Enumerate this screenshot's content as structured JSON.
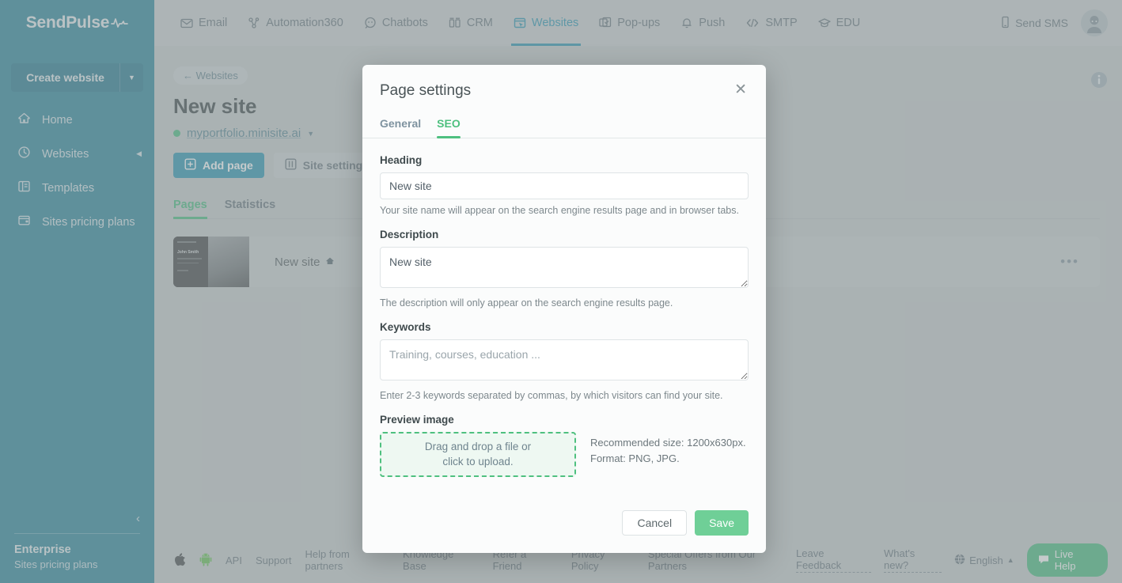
{
  "brand": {
    "name": "SendPulse",
    "logo_icon": "pulse-wave-icon",
    "bg_color": "#1d7e96"
  },
  "topnav": {
    "items": [
      {
        "label": "Email",
        "icon": "envelope-icon",
        "active": false
      },
      {
        "label": "Automation360",
        "icon": "flow-nodes-icon",
        "active": false
      },
      {
        "label": "Chatbots",
        "icon": "chat-bubble-icon",
        "active": false
      },
      {
        "label": "CRM",
        "icon": "crm-board-icon",
        "active": false
      },
      {
        "label": "Websites",
        "icon": "website-cursor-icon",
        "active": true
      },
      {
        "label": "Pop-ups",
        "icon": "popup-check-icon",
        "active": false
      },
      {
        "label": "Push",
        "icon": "bell-icon",
        "active": false
      },
      {
        "label": "SMTP",
        "icon": "code-brackets-icon",
        "active": false
      },
      {
        "label": "EDU",
        "icon": "graduation-cap-icon",
        "active": false
      }
    ],
    "send_sms": {
      "label": "Send SMS",
      "icon": "mobile-phone-icon"
    },
    "avatar_icon": "user-avatar-icon",
    "active_color": "#1d8fae"
  },
  "sidebar": {
    "create_button": {
      "label": "Create website",
      "caret_icon": "chevron-down-icon"
    },
    "items": [
      {
        "label": "Home",
        "icon": "home-icon",
        "has_caret": false
      },
      {
        "label": "Websites",
        "icon": "globe-clock-icon",
        "has_caret": true
      },
      {
        "label": "Templates",
        "icon": "templates-icon",
        "has_caret": false
      },
      {
        "label": "Sites pricing plans",
        "icon": "pricing-card-icon",
        "has_caret": false
      }
    ],
    "collapse_icon": "chevron-left-icon",
    "plan_name": "Enterprise",
    "plan_link": "Sites pricing plans"
  },
  "main": {
    "back_pill": "← Websites",
    "page_title": "New site",
    "domain": {
      "url": "myportfolio.minisite.ai",
      "status_color": "#3cb878",
      "caret_icon": "caret-down-icon"
    },
    "buttons": [
      {
        "label": "Add page",
        "icon": "plus-square-icon",
        "style": "primary"
      },
      {
        "label": "Site settings",
        "icon": "sliders-icon",
        "style": "ghost"
      }
    ],
    "tabs": [
      {
        "label": "Pages",
        "active": true
      },
      {
        "label": "Statistics",
        "active": false
      }
    ],
    "pages": [
      {
        "name": "New site",
        "badge_icon": "home-small-icon",
        "thumb_name": "John Smith",
        "menu_icon": "ellipsis-icon"
      }
    ],
    "info_icon": "info-circle-icon"
  },
  "footer": {
    "left_icons": [
      {
        "icon": "apple-icon"
      },
      {
        "icon": "android-icon"
      }
    ],
    "links": [
      "API",
      "Support",
      "Help from partners",
      "Knowledge Base",
      "Refer a Friend",
      "Privacy Policy",
      "Special Offers from Our Partners"
    ],
    "leave_feedback": "Leave Feedback",
    "whats_new": "What's new?",
    "language": {
      "label": "English",
      "icon": "globe-icon",
      "caret_icon": "caret-up-icon"
    },
    "live_help": {
      "label": "Live Help",
      "icon": "chat-icon",
      "color": "#3cb878"
    }
  },
  "modal": {
    "title": "Page settings",
    "close_icon": "close-icon",
    "tabs": [
      {
        "label": "General",
        "active": false
      },
      {
        "label": "SEO",
        "active": true
      }
    ],
    "accent_color": "#4ec07f",
    "heading": {
      "label": "Heading",
      "value": "New site",
      "placeholder": "",
      "hint": "Your site name will appear on the search engine results page and in browser tabs."
    },
    "description": {
      "label": "Description",
      "value": "New site",
      "placeholder": "",
      "hint": "The description will only appear on the search engine results page."
    },
    "keywords": {
      "label": "Keywords",
      "value": "",
      "placeholder": "Training, courses, education ...",
      "hint": "Enter 2-3 keywords separated by commas, by which visitors can find your site."
    },
    "preview_image": {
      "label": "Preview image",
      "dropzone_line1": "Drag and drop a file or",
      "dropzone_line2": "click to upload.",
      "info_line1": "Recommended size: 1200x630px.",
      "info_line2": "Format: PNG, JPG."
    },
    "footer": {
      "cancel_label": "Cancel",
      "save_label": "Save"
    }
  }
}
